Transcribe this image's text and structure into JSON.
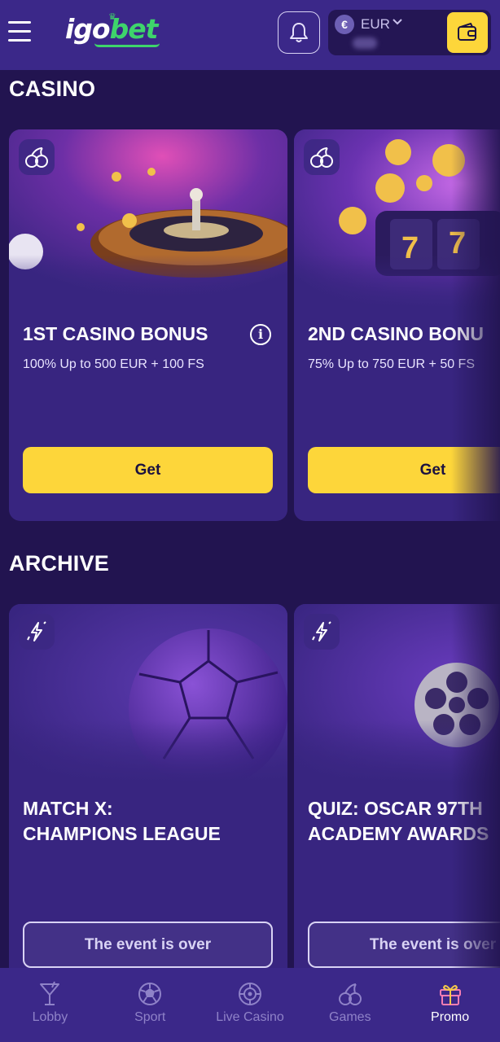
{
  "header": {
    "logo_part1": "igo",
    "logo_part2": "bet",
    "currency": "EUR",
    "currency_symbol": "€"
  },
  "sections": {
    "casino": {
      "title": "CASINO",
      "cards": [
        {
          "title": "1ST CASINO BONUS",
          "subtitle": "100% Up to 500 EUR + 100 FS",
          "button": "Get",
          "icon": "cherries-icon"
        },
        {
          "title": "2ND CASINO BONU",
          "subtitle": "75% Up to 750 EUR + 50 FS",
          "button": "Get",
          "icon": "cherries-icon"
        }
      ]
    },
    "archive": {
      "title": "ARCHIVE",
      "cards": [
        {
          "title_line1": "MATCH X:",
          "title_line2": "CHAMPIONS LEAGUE",
          "button": "The event is over",
          "icon": "lightning-icon"
        },
        {
          "title_line1": "QUIZ: OSCAR 97TH",
          "title_line2": "ACADEMY AWARDS",
          "button": "The event is over",
          "icon": "lightning-icon"
        }
      ]
    }
  },
  "bottom_nav": [
    {
      "label": "Lobby",
      "icon": "cocktail-icon",
      "active": false
    },
    {
      "label": "Sport",
      "icon": "soccer-ball-icon",
      "active": false
    },
    {
      "label": "Live Casino",
      "icon": "roulette-icon",
      "active": false
    },
    {
      "label": "Games",
      "icon": "cherries-icon",
      "active": false
    },
    {
      "label": "Promo",
      "icon": "gift-icon",
      "active": true
    }
  ],
  "colors": {
    "header_bg": "#3b2889",
    "page_bg": "#221450",
    "card_bg": "#382580",
    "accent_yellow": "#fdd63a",
    "logo_green": "#3ed46b"
  }
}
